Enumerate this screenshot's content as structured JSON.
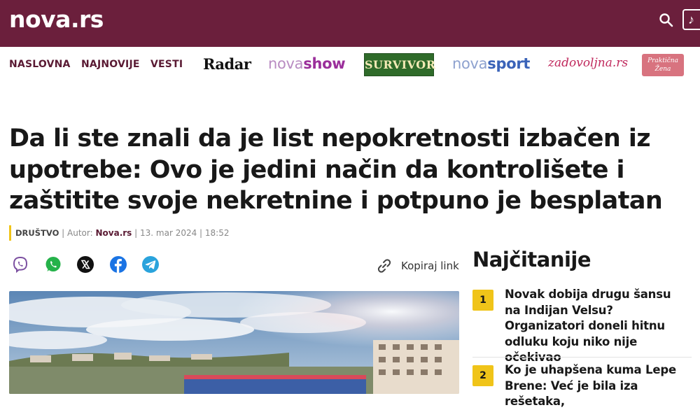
{
  "header": {
    "logo": "nova.rs",
    "search_icon": "search-icon",
    "music_icon": "music-note-icon"
  },
  "nav": {
    "links": [
      "NASLOVNA",
      "NAJNOVIJE",
      "VESTI"
    ],
    "brands": {
      "radar": "Radar",
      "novashow_a": "nova",
      "novashow_b": "show",
      "survivor": "SURVIVOR",
      "novasport_a": "nova",
      "novasport_b": "sport",
      "zadovoljna": "zadovoljna.rs",
      "prakticna_line1": "Praktična",
      "prakticna_line2": "Žena"
    }
  },
  "article": {
    "title": "Da li ste znali da je list nepokretnosti izbačen iz upotrebe: Ovo je jedini način da kontrolišete i zaštitite svoje nekretnine i potpuno je besplatan",
    "category": "DRUŠTVO",
    "author_label": "| Autor:",
    "author": "Nova.rs",
    "date": "| 13. mar 2024 | 18:52",
    "share_icons": [
      "viber-icon",
      "whatsapp-icon",
      "x-icon",
      "facebook-icon",
      "telegram-icon"
    ],
    "copy_link_label": "Kopiraj link"
  },
  "sidebar": {
    "title": "Najčitanije",
    "items": [
      {
        "num": "1",
        "text": "Novak dobija drugu šansu na Indijan Velsu? Organizatori doneli hitnu odluku koju niko nije očekivao"
      },
      {
        "num": "2",
        "text": "Ko je uhapšena kuma Lepe Brene: Već je bila iza rešetaka,"
      }
    ]
  },
  "colors": {
    "header_bg": "#6b1f3c",
    "nav_text": "#5a1a33",
    "accent_yellow": "#f0c419"
  }
}
